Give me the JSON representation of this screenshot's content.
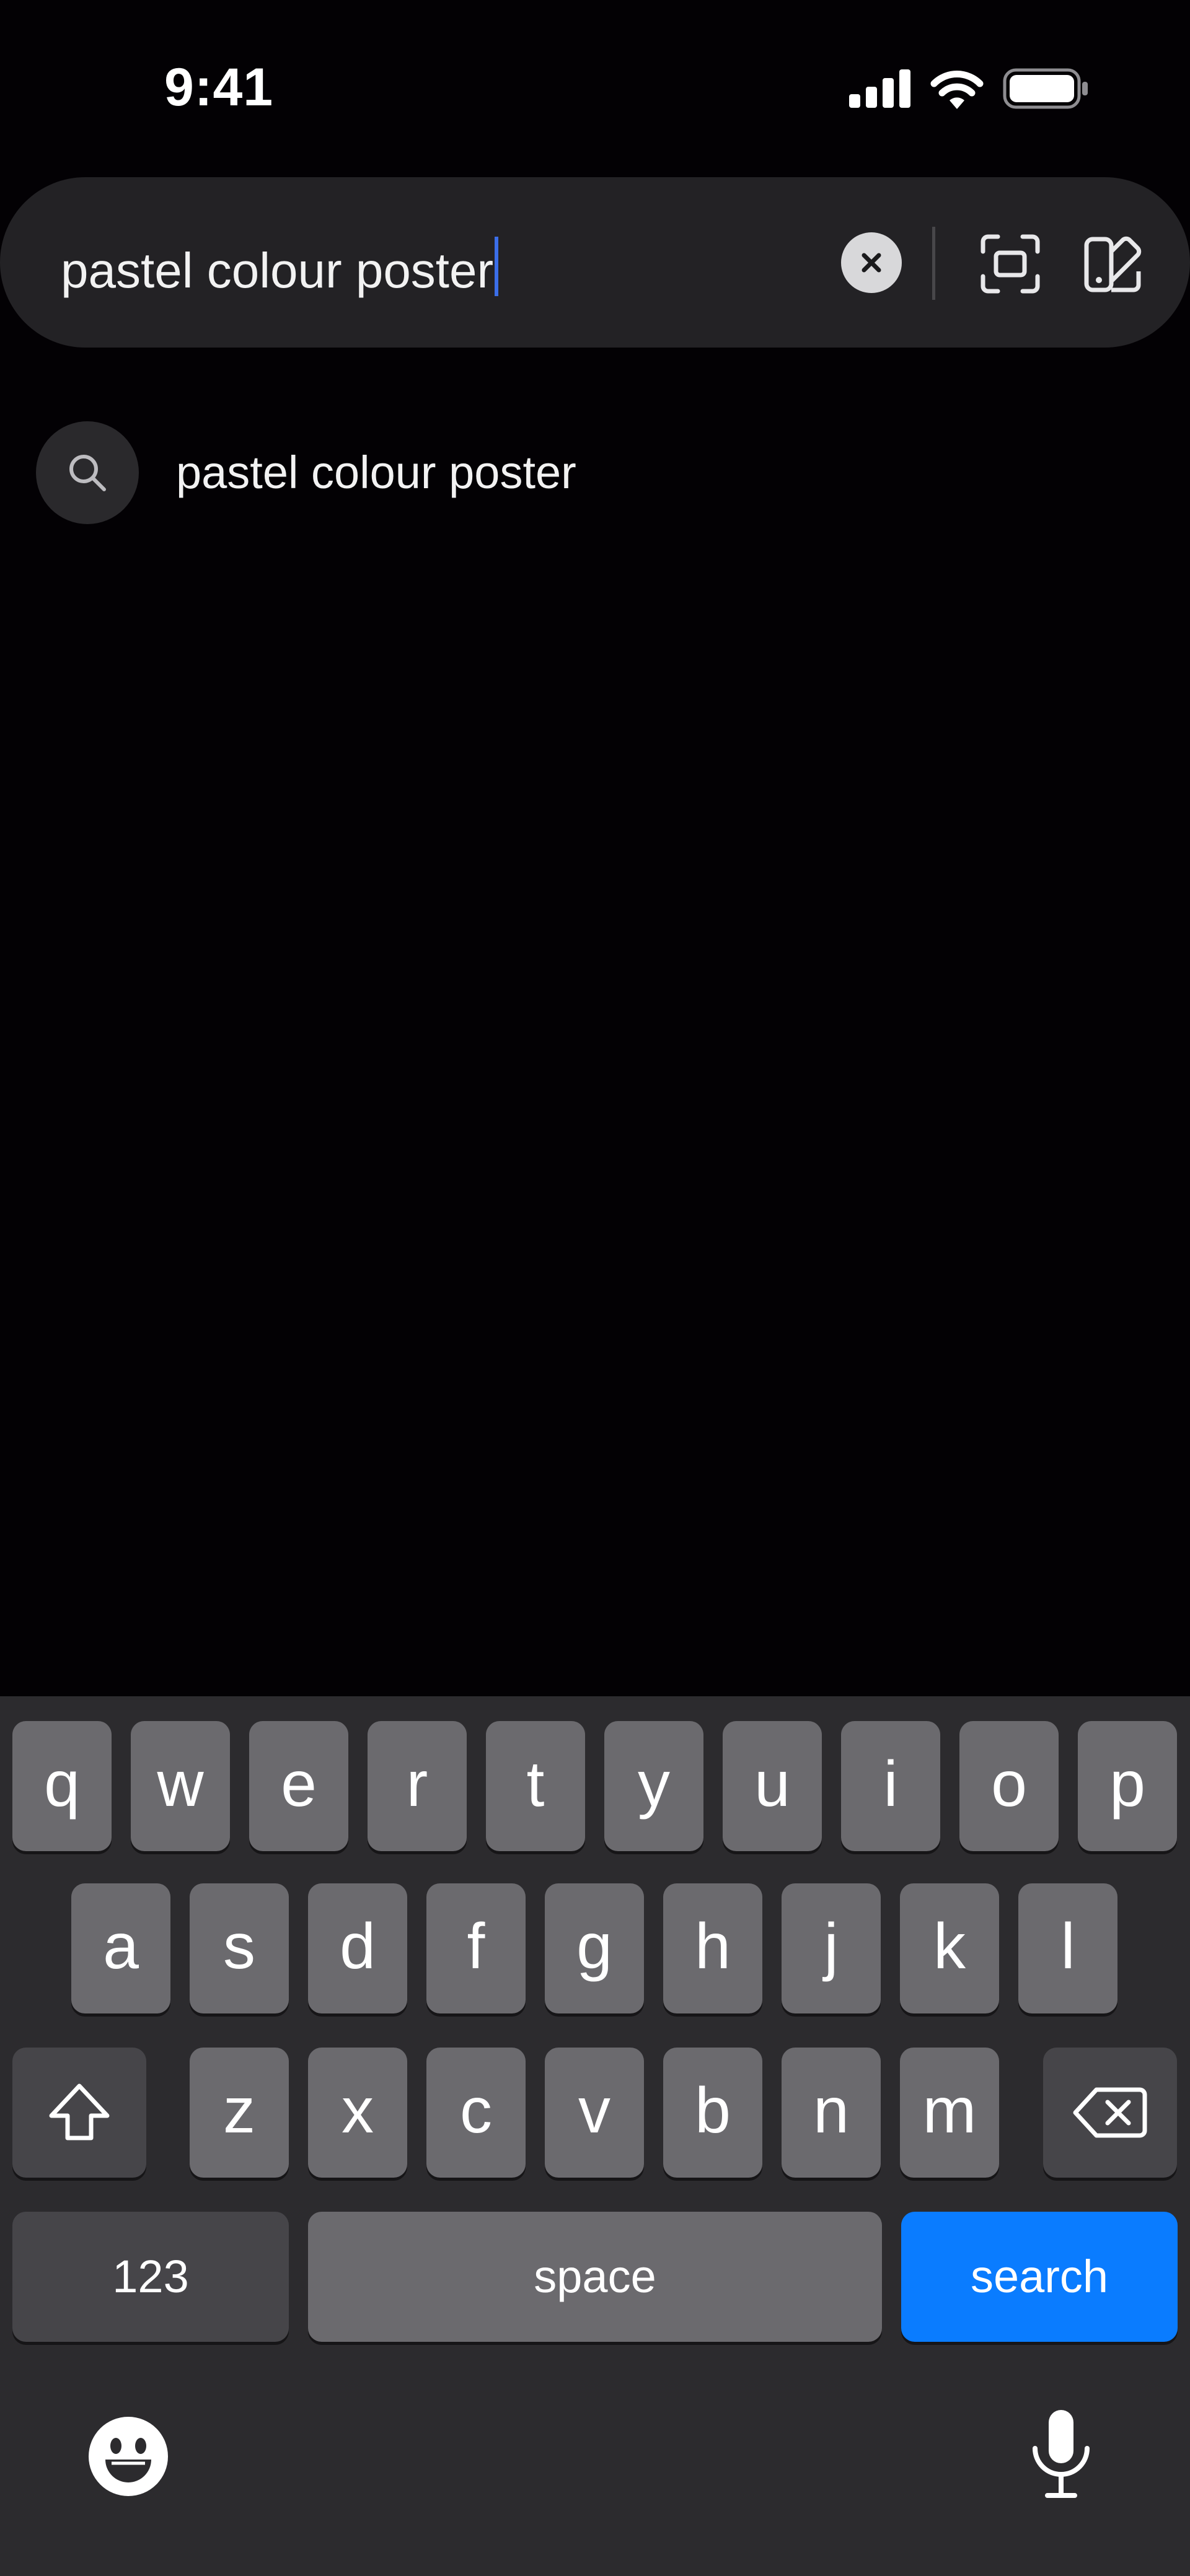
{
  "status_bar": {
    "time": "9:41",
    "icons": [
      "signal-icon",
      "wifi-icon",
      "battery-icon"
    ]
  },
  "search": {
    "value": "pastel colour poster",
    "buttons": [
      "clear-icon",
      "scan-icon",
      "style-icon"
    ]
  },
  "suggestions": [
    {
      "label": "pastel colour poster",
      "icon": "search-icon"
    }
  ],
  "keyboard": {
    "row1": [
      "q",
      "w",
      "e",
      "r",
      "t",
      "y",
      "u",
      "i",
      "o",
      "p"
    ],
    "row2": [
      "a",
      "s",
      "d",
      "f",
      "g",
      "h",
      "j",
      "k",
      "l"
    ],
    "row3": [
      "z",
      "x",
      "c",
      "v",
      "b",
      "n",
      "m"
    ],
    "numbers_label": "123",
    "space_label": "space",
    "search_label": "search",
    "bottom_icons": [
      "emoji-icon",
      "microphone-icon"
    ]
  },
  "colors": {
    "background": "#030104",
    "search_bar": "#232225",
    "caret": "#3b6ee8",
    "key": "#6b6a6e",
    "key_dark": "#464549",
    "search_key": "#0a7cff",
    "keyboard_bg": "#2c2b2e"
  }
}
